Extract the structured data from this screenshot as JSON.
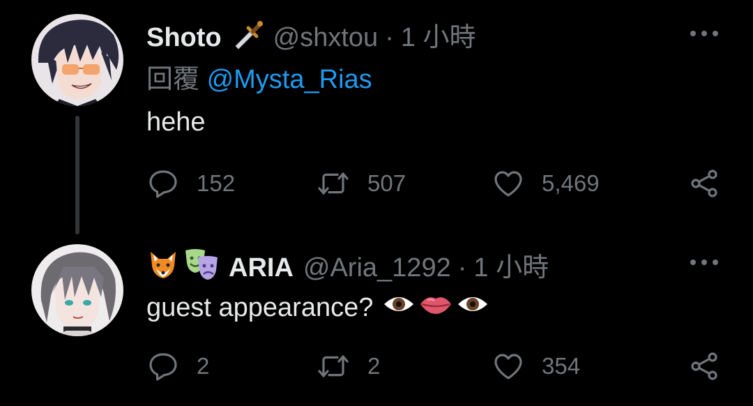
{
  "thread": [
    {
      "display_name": "Shoto",
      "name_emoji": "dagger-emoji",
      "handle": "@shxtou",
      "separator": "·",
      "time": "1 小時",
      "reply_prefix": "回覆",
      "reply_to": "@Mysta_Rias",
      "text": "hehe",
      "counts": {
        "replies": "152",
        "retweets": "507",
        "likes": "5,469"
      },
      "avatar_icon": "avatar-dark-hair-orange-glasses"
    },
    {
      "display_name": "ARIA",
      "name_emojis": [
        "fox-emoji",
        "performing-arts-emoji"
      ],
      "handle": "@Aria_1292",
      "separator": "·",
      "time": "1 小時",
      "text": "guest appearance?",
      "text_emojis": [
        "eye-emoji",
        "lips-emoji",
        "eye-emoji"
      ],
      "counts": {
        "replies": "2",
        "retweets": "2",
        "likes": "354"
      },
      "avatar_icon": "avatar-grey-hair"
    }
  ],
  "icons": {
    "reply": "speech-bubble-icon",
    "retweet": "retweet-arrows-icon",
    "like": "heart-icon",
    "share": "share-icon",
    "more": "more-dots-icon"
  },
  "colors": {
    "background": "#000000",
    "text": "#e7e9ea",
    "secondary": "#71767b",
    "link": "#1d9bf0",
    "thread_line": "#333639"
  }
}
